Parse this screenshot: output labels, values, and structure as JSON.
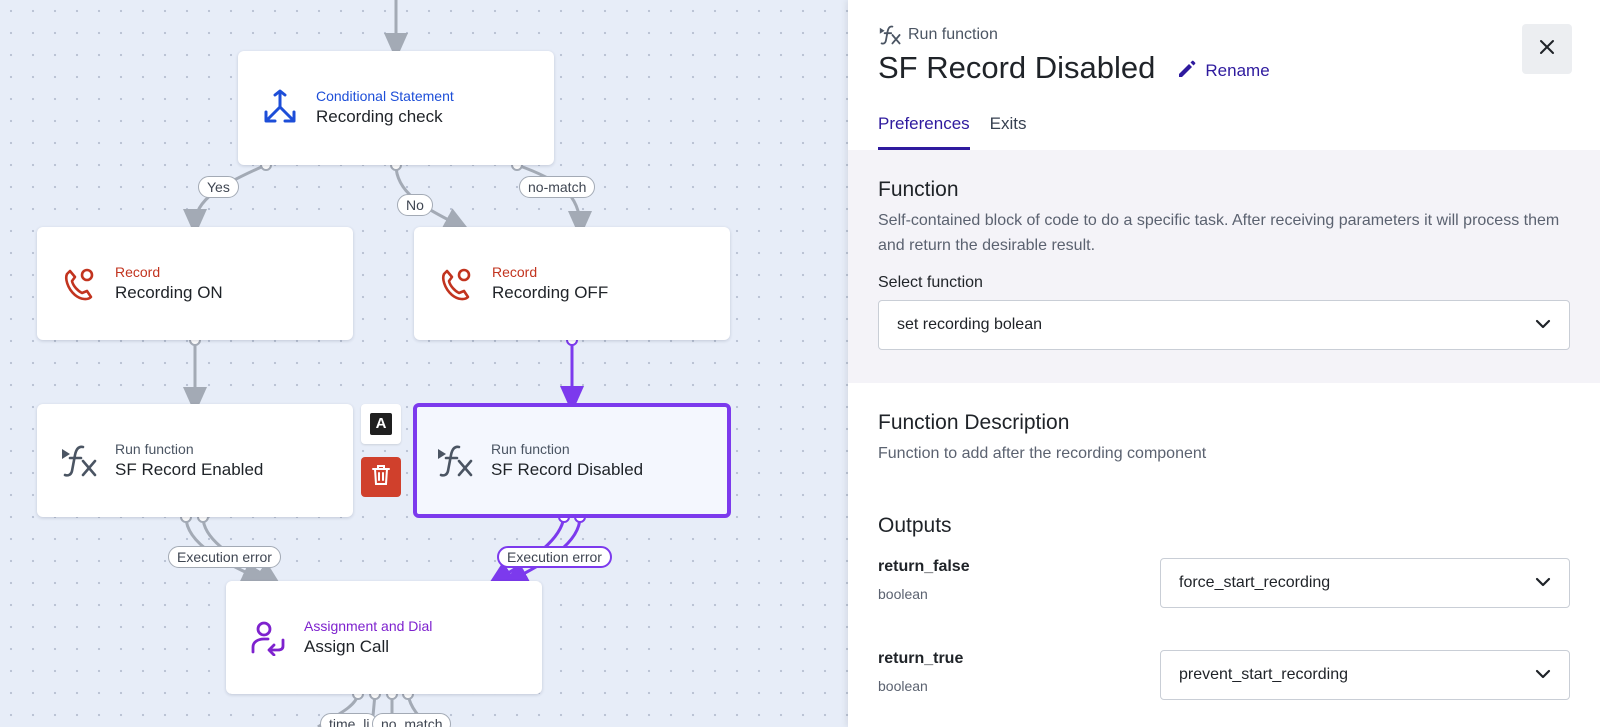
{
  "canvas": {
    "nodes": [
      {
        "id": "conditional",
        "type_label": "Conditional Statement",
        "name": "Recording check",
        "icon": "split-arrows-icon",
        "color": "#1d4ed8"
      },
      {
        "id": "record-on",
        "type_label": "Record",
        "name": "Recording ON",
        "icon": "phone-record-icon",
        "color": "#c2341f"
      },
      {
        "id": "record-off",
        "type_label": "Record",
        "name": "Recording OFF",
        "icon": "phone-record-icon",
        "color": "#c2341f"
      },
      {
        "id": "sf-enabled",
        "type_label": "Run function",
        "name": "SF Record Enabled",
        "icon": "function-icon",
        "color": "#4b5563"
      },
      {
        "id": "sf-disabled",
        "type_label": "Run function",
        "name": "SF Record Disabled",
        "icon": "function-icon",
        "color": "#4b5563",
        "selected": true
      },
      {
        "id": "assign",
        "type_label": "Assignment and Dial",
        "name": "Assign Call",
        "icon": "assign-user-icon",
        "color": "#7e22ce"
      }
    ],
    "edge_labels": {
      "yes": "Yes",
      "no": "No",
      "no_match": "no-match",
      "exec_error_left": "Execution error",
      "exec_error_right": "Execution error",
      "time_limit": "time_li",
      "no_match_bottom": "no_match"
    },
    "toolbar": {
      "text_icon": "A",
      "delete_icon": "trash-icon"
    },
    "colors": {
      "wire": "#a3aab5",
      "active_wire": "#7c3aed"
    }
  },
  "panel": {
    "subtitle": "Run function",
    "title": "SF Record Disabled",
    "rename_label": "Rename",
    "close_icon": "close-icon",
    "tabs": [
      {
        "label": "Preferences",
        "active": true
      },
      {
        "label": "Exits",
        "active": false
      }
    ],
    "function": {
      "heading": "Function",
      "description": "Self-contained block of code to do a specific task. After receiving parameters it will process them and return the desirable result.",
      "select_label": "Select function",
      "selected_value": "set recording bolean"
    },
    "function_description": {
      "heading": "Function Description",
      "text": "Function to add after the recording component"
    },
    "outputs": {
      "heading": "Outputs",
      "items": [
        {
          "name": "return_false",
          "type": "boolean",
          "value": "force_start_recording"
        },
        {
          "name": "return_true",
          "type": "boolean",
          "value": "prevent_start_recording"
        }
      ]
    },
    "colors": {
      "accent": "#2e1a9e",
      "section_bg": "#f4f3f8"
    }
  }
}
